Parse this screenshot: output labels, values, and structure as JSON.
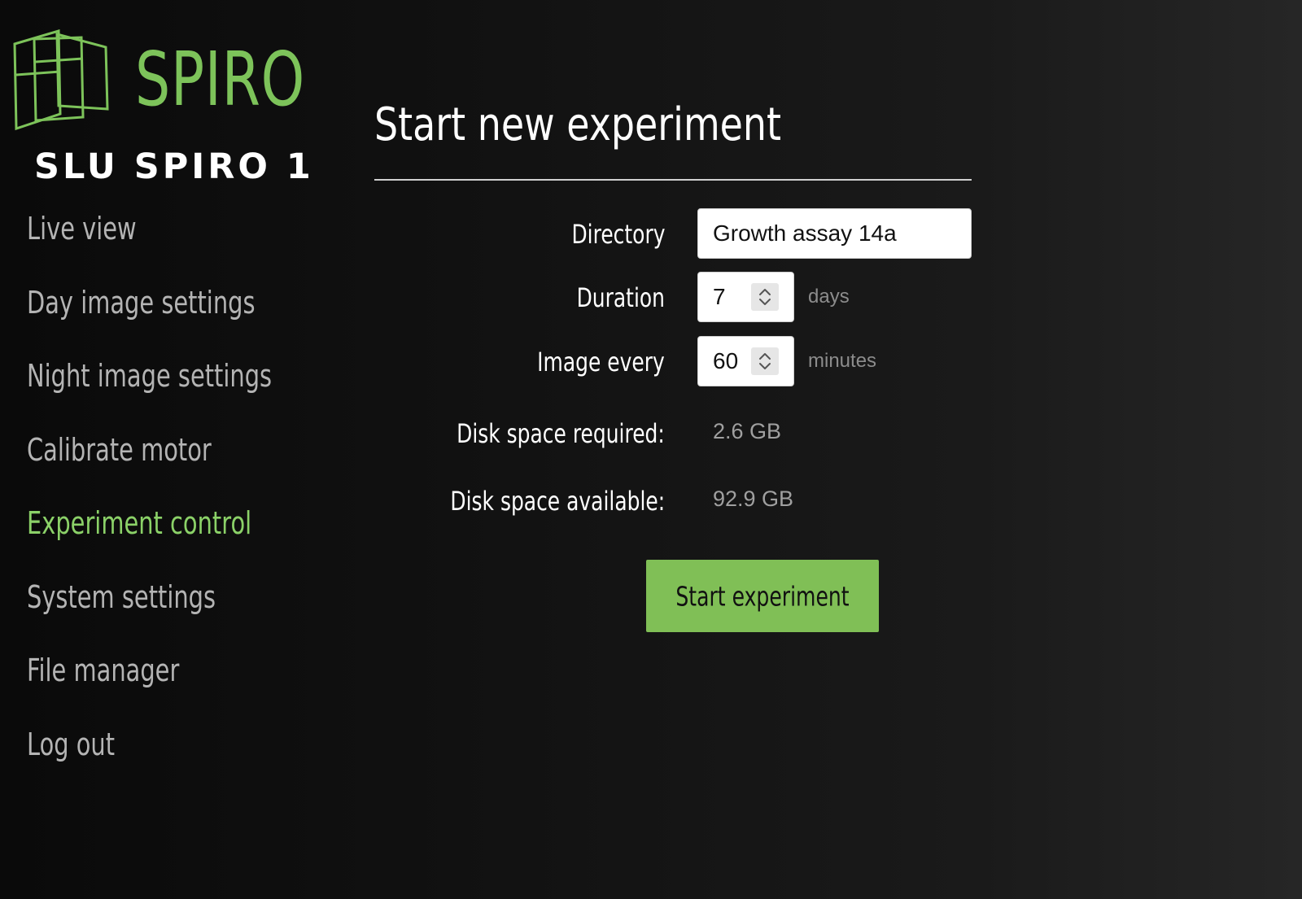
{
  "brand": {
    "logo_text": "SPIRO",
    "device_name": "SLU SPIRO 1",
    "logo_icon": "stacked-frames-logo",
    "accent_color": "#7dc35a"
  },
  "sidebar": {
    "items": [
      {
        "label": "Live view",
        "active": false
      },
      {
        "label": "Day image settings",
        "active": false
      },
      {
        "label": "Night image settings",
        "active": false
      },
      {
        "label": "Calibrate motor",
        "active": false
      },
      {
        "label": "Experiment control",
        "active": true
      },
      {
        "label": "System settings",
        "active": false
      },
      {
        "label": "File manager",
        "active": false
      },
      {
        "label": "Log out",
        "active": false
      }
    ],
    "active_color": "#8bd168",
    "inactive_color": "#b4b4b4"
  },
  "main": {
    "title": "Start new experiment",
    "form": {
      "directory": {
        "label": "Directory",
        "value": "Growth assay 14a"
      },
      "duration": {
        "label": "Duration",
        "value": "7",
        "unit": "days",
        "spin_icon": "up-down-chevron-icon"
      },
      "interval": {
        "label": "Image every",
        "value": "60",
        "unit": "minutes",
        "spin_icon": "up-down-chevron-icon"
      },
      "disk_required": {
        "label": "Disk space required:",
        "value": "2.6 GB"
      },
      "disk_available": {
        "label": "Disk space available:",
        "value": "92.9 GB"
      }
    },
    "start_button": {
      "label": "Start experiment",
      "color": "#80bf56"
    }
  }
}
